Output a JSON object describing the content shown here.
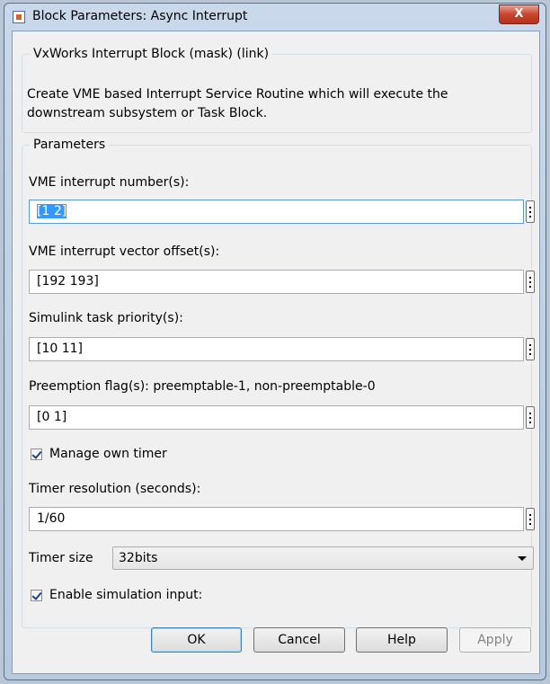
{
  "window": {
    "title": "Block Parameters: Async Interrupt",
    "close_glyph": "X"
  },
  "description": {
    "group_title": "VxWorks Interrupt Block (mask) (link)",
    "text": "Create VME based Interrupt Service Routine which will execute the downstream subsystem or Task Block."
  },
  "parameters": {
    "group_title": "Parameters",
    "vme_interrupt_numbers": {
      "label": "VME interrupt number(s):",
      "value": "[1 2]"
    },
    "vme_vector_offsets": {
      "label": "VME interrupt vector offset(s):",
      "value": "[192 193]"
    },
    "task_priorities": {
      "label": "Simulink task priority(s):",
      "value": "[10 11]"
    },
    "preemption_flags": {
      "label": "Preemption flag(s): preemptable-1, non-preemptable-0",
      "value": "[0 1]"
    },
    "manage_own_timer": {
      "label": "Manage own timer",
      "checked": true
    },
    "timer_resolution": {
      "label": "Timer resolution (seconds):",
      "value": "1/60"
    },
    "timer_size": {
      "label": "Timer size",
      "value": "32bits"
    },
    "enable_sim_input": {
      "label": "Enable simulation input:",
      "checked": true
    }
  },
  "buttons": {
    "ok": "OK",
    "cancel": "Cancel",
    "help": "Help",
    "apply": "Apply"
  },
  "icons": [
    "app-icon",
    "close-icon",
    "more-options-icon",
    "checkmark-icon",
    "dropdown-arrow-icon"
  ]
}
